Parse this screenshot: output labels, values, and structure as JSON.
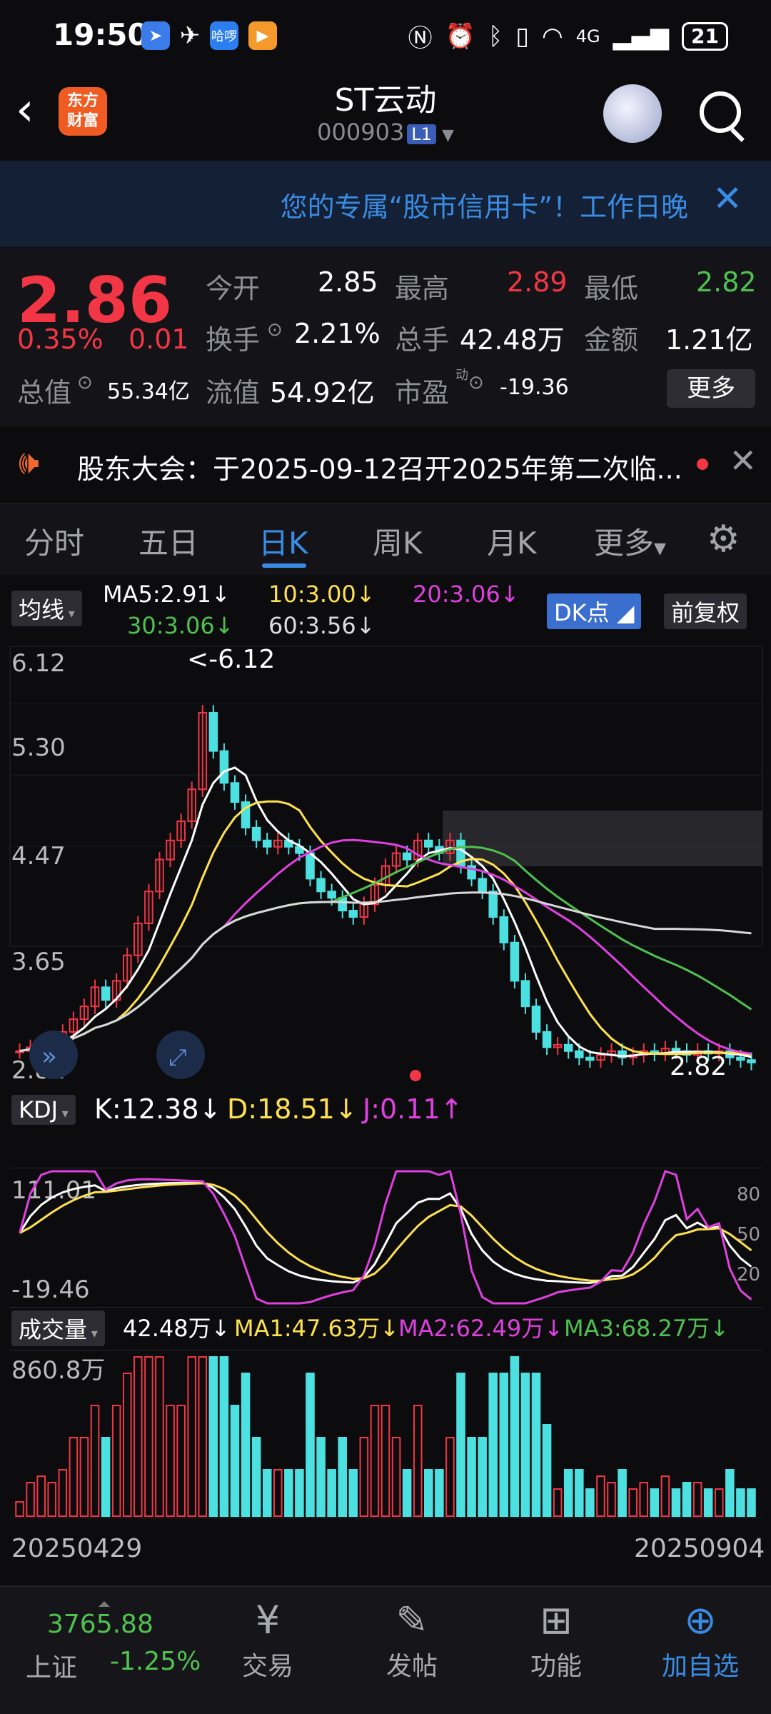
{
  "status_bar": {
    "time": "19:50",
    "battery": "21",
    "network": "4G"
  },
  "header": {
    "title": "ST云动",
    "code": "000903",
    "level": "L1",
    "logo_line1": "东方",
    "logo_line2": "财富"
  },
  "banner": {
    "text": "您的专属“股市信用卡”！工作日晚"
  },
  "quote": {
    "price": "2.86",
    "change_pct": "0.35%",
    "change": "0.01",
    "open_label": "今开",
    "open": "2.85",
    "high_label": "最高",
    "high": "2.89",
    "low_label": "最低",
    "low": "2.82",
    "turnover_label": "换手",
    "turnover": "2.21%",
    "volume_label": "总手",
    "volume": "42.48万",
    "amount_label": "金额",
    "amount": "1.21亿",
    "mktcap_label": "总值",
    "mktcap": "55.34亿",
    "float_label": "流值",
    "float": "54.92亿",
    "pe_label": "市盈",
    "pe_sup": "动",
    "pe": "-19.36",
    "more": "更多"
  },
  "notice": {
    "text": "股东大会：于2025-09-12召开2025年第二次临..."
  },
  "tabs": [
    "分时",
    "五日",
    "日K",
    "周K",
    "月K",
    "更多"
  ],
  "active_tab": "日K",
  "ma": {
    "selector": "均线",
    "ma5": "MA5:2.91",
    "ma10": "10:3.00",
    "ma20": "20:3.06",
    "ma30": "30:3.06",
    "ma60": "60:3.56",
    "dk": "DK点",
    "adjust": "前复权",
    "colors": {
      "ma5": "#ffffff",
      "ma10": "#ffe14d",
      "ma20": "#e040e0",
      "ma30": "#4fc14f",
      "ma60": "#d8d8d8"
    }
  },
  "price_axis": [
    "6.12",
    "5.30",
    "4.47",
    "3.65",
    "2.82"
  ],
  "price_annotations": {
    "max": "<-6.12",
    "min": "2.82"
  },
  "kdj": {
    "selector": "KDJ",
    "k": "K:12.38",
    "d": "D:18.51",
    "j": "J:0.11",
    "axis_top": "111.01",
    "axis_bottom": "-19.46",
    "ref": [
      "80",
      "50",
      "20"
    ]
  },
  "volume": {
    "selector": "成交量",
    "value": "42.48万",
    "ma1": "MA1:47.63万",
    "ma2": "MA2:62.49万",
    "ma3": "MA3:68.27万",
    "axis_top": "860.8万"
  },
  "dates": {
    "start": "20250429",
    "end": "20250904"
  },
  "bottom_bar": {
    "index_value": "3765.88",
    "index_name": "上证",
    "index_change": "-1.25%",
    "items": [
      "交易",
      "发帖",
      "功能",
      "加自选"
    ]
  },
  "chart_data": {
    "type": "candlestick",
    "ylim": [
      2.82,
      6.12
    ],
    "closes": [
      2.95,
      2.98,
      3.02,
      3.05,
      3.1,
      3.2,
      3.3,
      3.45,
      3.35,
      3.5,
      3.7,
      3.95,
      4.2,
      4.45,
      4.6,
      4.75,
      5.0,
      5.6,
      5.3,
      5.05,
      4.9,
      4.7,
      4.6,
      4.55,
      4.6,
      4.55,
      4.5,
      4.3,
      4.2,
      4.15,
      4.05,
      4.0,
      4.1,
      4.25,
      4.4,
      4.5,
      4.45,
      4.6,
      4.55,
      4.5,
      4.6,
      4.4,
      4.3,
      4.2,
      4.0,
      3.8,
      3.5,
      3.3,
      3.1,
      2.98,
      3.0,
      2.95,
      2.9,
      2.88,
      2.92,
      2.95,
      2.9,
      2.92,
      2.95,
      2.93,
      2.97,
      2.95,
      2.92,
      2.95,
      2.93,
      2.95,
      2.9,
      2.88,
      2.86
    ]
  }
}
